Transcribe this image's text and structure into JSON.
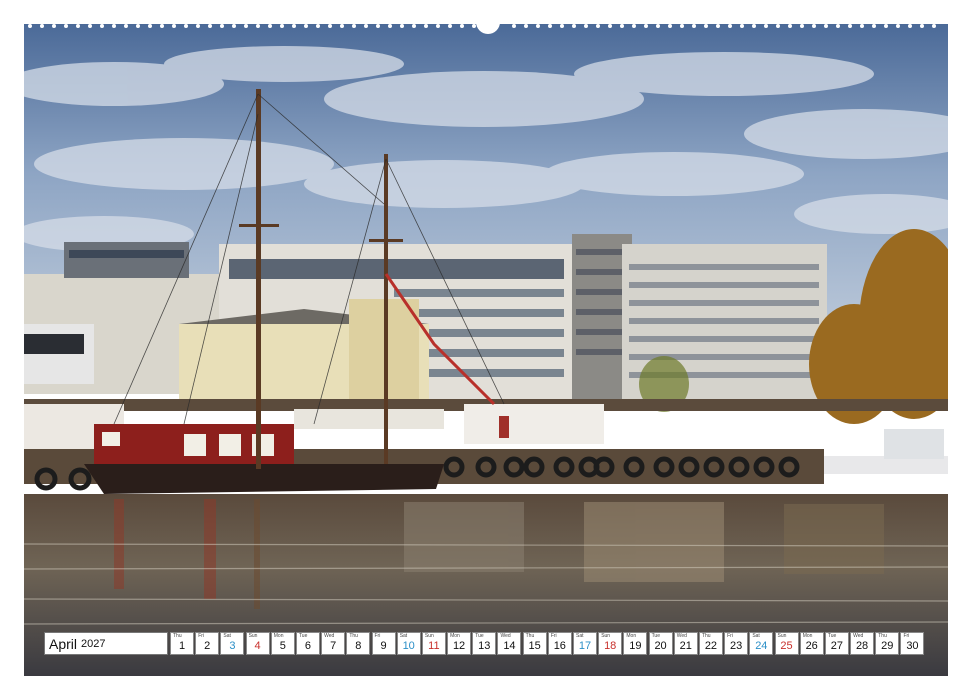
{
  "calendar": {
    "month": "April",
    "year": "2027",
    "days": [
      {
        "wd": "Thu",
        "n": "1",
        "t": "w"
      },
      {
        "wd": "Fri",
        "n": "2",
        "t": "w"
      },
      {
        "wd": "Sat",
        "n": "3",
        "t": "sat"
      },
      {
        "wd": "Sun",
        "n": "4",
        "t": "sun"
      },
      {
        "wd": "Mon",
        "n": "5",
        "t": "w"
      },
      {
        "wd": "Tue",
        "n": "6",
        "t": "w"
      },
      {
        "wd": "Wed",
        "n": "7",
        "t": "w"
      },
      {
        "wd": "Thu",
        "n": "8",
        "t": "w"
      },
      {
        "wd": "Fri",
        "n": "9",
        "t": "w"
      },
      {
        "wd": "Sat",
        "n": "10",
        "t": "sat"
      },
      {
        "wd": "Sun",
        "n": "11",
        "t": "sun"
      },
      {
        "wd": "Mon",
        "n": "12",
        "t": "w"
      },
      {
        "wd": "Tue",
        "n": "13",
        "t": "w"
      },
      {
        "wd": "Wed",
        "n": "14",
        "t": "w"
      },
      {
        "wd": "Thu",
        "n": "15",
        "t": "w"
      },
      {
        "wd": "Fri",
        "n": "16",
        "t": "w"
      },
      {
        "wd": "Sat",
        "n": "17",
        "t": "sat"
      },
      {
        "wd": "Sun",
        "n": "18",
        "t": "sun"
      },
      {
        "wd": "Mon",
        "n": "19",
        "t": "w"
      },
      {
        "wd": "Tue",
        "n": "20",
        "t": "w"
      },
      {
        "wd": "Wed",
        "n": "21",
        "t": "w"
      },
      {
        "wd": "Thu",
        "n": "22",
        "t": "w"
      },
      {
        "wd": "Fri",
        "n": "23",
        "t": "w"
      },
      {
        "wd": "Sat",
        "n": "24",
        "t": "sat"
      },
      {
        "wd": "Sun",
        "n": "25",
        "t": "sun"
      },
      {
        "wd": "Mon",
        "n": "26",
        "t": "w"
      },
      {
        "wd": "Tue",
        "n": "27",
        "t": "w"
      },
      {
        "wd": "Wed",
        "n": "28",
        "t": "w"
      },
      {
        "wd": "Thu",
        "n": "29",
        "t": "w"
      },
      {
        "wd": "Fri",
        "n": "30",
        "t": "w"
      }
    ]
  },
  "colors": {
    "saturday": "#2b8fc7",
    "sunday": "#c8302c"
  }
}
